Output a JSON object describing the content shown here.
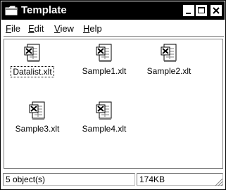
{
  "window": {
    "title": "Template",
    "title_icon": "folder-icon",
    "controls": [
      "minimize-icon",
      "maximize-icon",
      "close-icon"
    ]
  },
  "menu": [
    {
      "label": "File",
      "accelerator": "F",
      "rest": "ile"
    },
    {
      "label": "Edit",
      "accelerator": "E",
      "rest": "dit"
    },
    {
      "label": "View",
      "accelerator": "V",
      "rest": "iew"
    },
    {
      "label": "Help",
      "accelerator": "H",
      "rest": "elp"
    }
  ],
  "files": [
    {
      "name": "Datalist.xlt",
      "icon": "excel-template-icon",
      "selected": true
    },
    {
      "name": "Sample1.xlt",
      "icon": "excel-template-icon",
      "selected": false
    },
    {
      "name": "Sample2.xlt",
      "icon": "excel-template-icon",
      "selected": false
    },
    {
      "name": "Sample3.xlt",
      "icon": "excel-template-icon",
      "selected": false
    },
    {
      "name": "Sample4.xlt",
      "icon": "excel-template-icon",
      "selected": false
    }
  ],
  "status": {
    "object_count": "5 object(s)",
    "size": "174KB"
  },
  "colors": {
    "titlebar": "#000000",
    "background": "#ffffff"
  }
}
